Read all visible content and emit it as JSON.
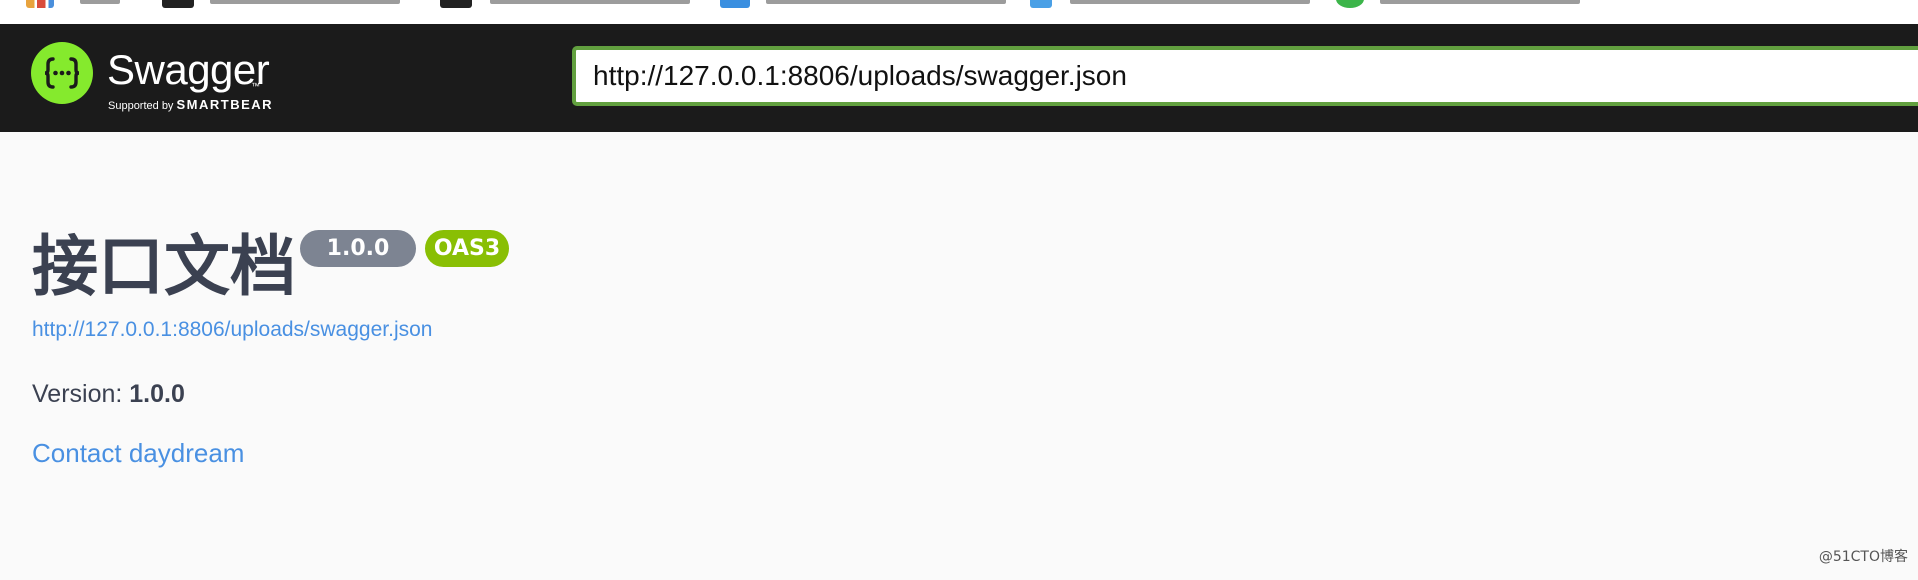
{
  "header": {
    "brand_name": "Swagger",
    "brand_tm": "™",
    "brand_supported_by": "Supported by",
    "brand_company": "SMARTBEAR",
    "spec_url_value": "http://127.0.0.1:8806/uploads/swagger.json",
    "accent_color": "#85ea2d",
    "input_border_color": "#62a03f",
    "logo_icon": "swagger-braces-icon"
  },
  "info": {
    "title": "接口文档",
    "version_badge": "1.0.0",
    "oas_badge": "OAS3",
    "spec_link": "http://127.0.0.1:8806/uploads/swagger.json",
    "version_label": "Version: ",
    "version_value": "1.0.0",
    "contact_link": "Contact daydream"
  },
  "watermark": "@51CTO博客"
}
